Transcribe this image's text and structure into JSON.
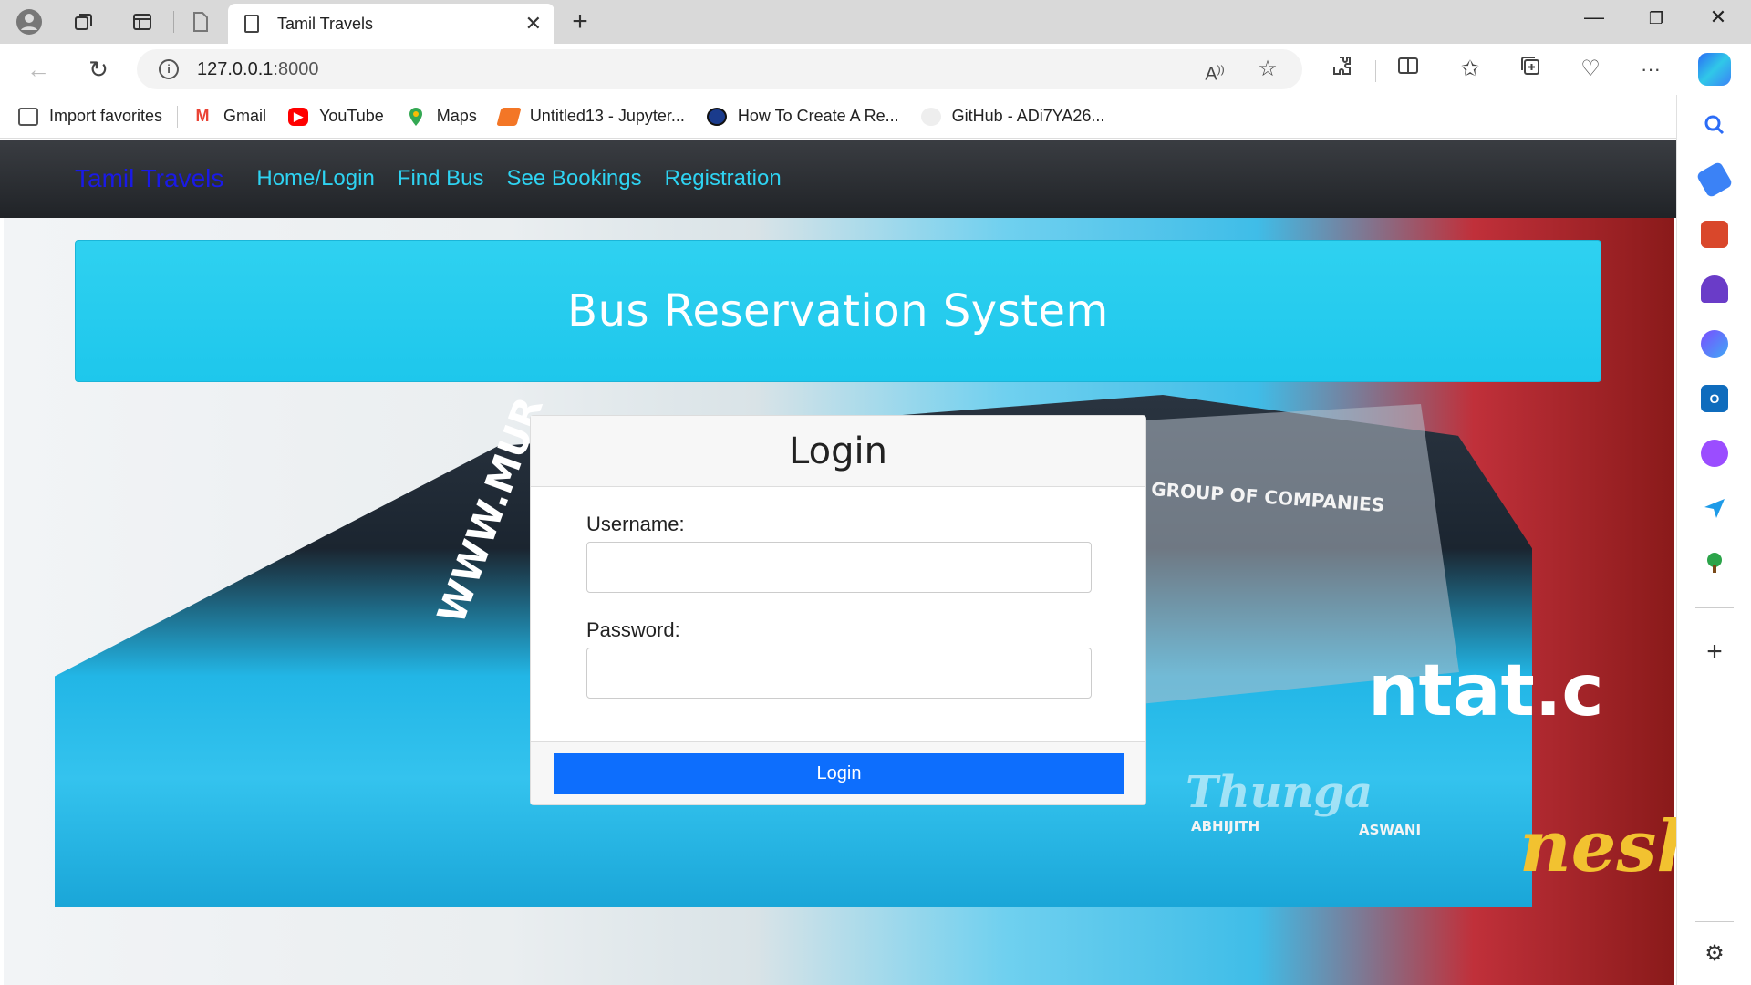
{
  "browser": {
    "tab_title": "Tamil Travels",
    "url_host": "127.0.0.1",
    "url_port": ":8000",
    "bookmarks": [
      {
        "label": "Import favorites",
        "icon": "import-favorites-icon",
        "color": "#555555"
      },
      {
        "label": "Gmail",
        "icon": "gmail-icon",
        "color": "#EA4335"
      },
      {
        "label": "YouTube",
        "icon": "youtube-icon",
        "color": "#FF0000"
      },
      {
        "label": "Maps",
        "icon": "maps-icon",
        "color": "#34A853"
      },
      {
        "label": "Untitled13 - Jupyter...",
        "icon": "jupyter-icon",
        "color": "#F37626"
      },
      {
        "label": "How To Create A Re...",
        "icon": "globe-avatar-icon",
        "color": "#1a3b8c"
      },
      {
        "label": "GitHub - ADi7YA26...",
        "icon": "github-icon",
        "color": "#dddddd"
      }
    ]
  },
  "navbar": {
    "brand": "Tamil Travels",
    "links": [
      "Home/Login",
      "Find Bus",
      "See Bookings",
      "Registration"
    ],
    "colors": {
      "brand": "#1a1ae6",
      "link": "#2ed3f2",
      "background": "#2a2d31"
    }
  },
  "jumbotron": {
    "title": "Bus Reservation System",
    "color": "#27ccee"
  },
  "login_card": {
    "title": "Login",
    "username_label": "Username:",
    "username_value": "",
    "password_label": "Password:",
    "password_value": "",
    "submit_label": "Login",
    "button_color": "#0d6efd"
  },
  "background_image": {
    "texts": [
      "GROUP OF COMPANIES",
      "ABHIJITH",
      "ASWANI",
      "Thunga",
      "ntat.c",
      "nesh",
      "WWW.MUR"
    ]
  }
}
